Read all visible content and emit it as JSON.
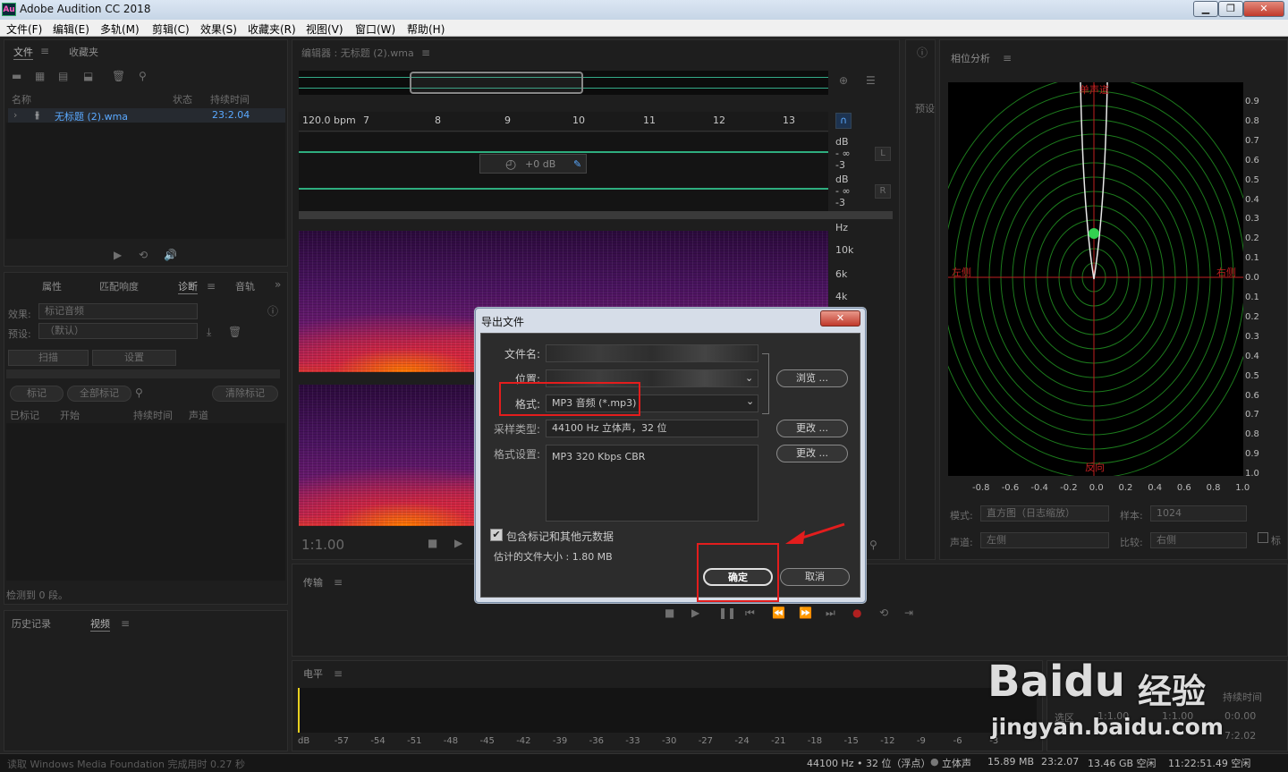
{
  "window": {
    "app_icon": "Au",
    "title": "Adobe Audition CC 2018",
    "min": "▁",
    "max": "❐",
    "close": "✕"
  },
  "menu": [
    "文件(F)",
    "编辑(E)",
    "多轨(M)",
    "剪辑(C)",
    "效果(S)",
    "收藏夹(R)",
    "视图(V)",
    "窗口(W)",
    "帮助(H)"
  ],
  "files_panel": {
    "tab_files": "文件",
    "tab_favorites": "收藏夹",
    "col_name": "名称",
    "col_status": "状态",
    "col_duration": "持续时间",
    "file_name": "无标题 (2).wma",
    "file_duration": "23:2.04"
  },
  "props_panel": {
    "tab_properties": "属性",
    "tab_match": "匹配响度",
    "tab_diagnostics": "诊断",
    "tab_audio": "音轨",
    "effect_label": "效果:",
    "effect_value": "标记音频",
    "preset_label": "预设:",
    "preset_value": "（默认）",
    "scan_button": "扫描",
    "settings_button": "设置",
    "mark_button": "标记",
    "mark_all_button": "全部标记",
    "clear_button": "清除标记",
    "col_marked": "已标记",
    "col_start": "开始",
    "col_duration": "持续时间",
    "col_channel": "声道",
    "detected": "检测到 0 段。"
  },
  "history_panel": {
    "tab_history": "历史记录",
    "tab_video": "视频"
  },
  "editor": {
    "title": "编辑器 : 无标题 (2).wma",
    "bpm": "120.0 bpm",
    "ruler": [
      "7",
      "8",
      "9",
      "10",
      "11",
      "12",
      "13"
    ],
    "db_labels": [
      "dB",
      "- ∞",
      "-3",
      "dB",
      "- ∞",
      "-3"
    ],
    "ch_left": "L",
    "ch_right": "R",
    "gain": "+0 dB",
    "hz_labels": [
      "Hz",
      "10k",
      "6k",
      "4k"
    ],
    "time": "1:1.00"
  },
  "transport_panel": {
    "title": "传输"
  },
  "levels_panel": {
    "title": "电平",
    "scale": [
      "dB",
      "-57",
      "-54",
      "-51",
      "-48",
      "-45",
      "-42",
      "-39",
      "-36",
      "-33",
      "-30",
      "-27",
      "-24",
      "-21",
      "-18",
      "-15",
      "-12",
      "-9",
      "-6",
      "-3"
    ]
  },
  "presets_tab": "预设",
  "phase_panel": {
    "title": "相位分析",
    "top_label": "单声道",
    "left_label": "左侧",
    "right_label": "右侧",
    "bottom_label": "反向",
    "y_ticks": [
      "0.9",
      "0.8",
      "0.7",
      "0.6",
      "0.5",
      "0.4",
      "0.3",
      "0.2",
      "0.1",
      "0.0",
      "0.1",
      "0.2",
      "0.3",
      "0.4",
      "0.5",
      "0.6",
      "0.7",
      "0.8",
      "0.9",
      "1.0"
    ],
    "x_ticks": [
      "-0.8",
      "-0.6",
      "-0.4",
      "-0.2",
      "0.0",
      "0.2",
      "0.4",
      "0.6",
      "0.8",
      "1.0"
    ],
    "mode_label": "模式:",
    "mode_value": "直方图（日志缩放）",
    "sample_label": "样本:",
    "sample_value": "1024",
    "channel_label": "声道:",
    "channel_value": "左侧",
    "compare_label": "比较:",
    "compare_value": "右侧",
    "mark_label": "标"
  },
  "selection_panel": {
    "duration_label": "持续时间",
    "selection_label": "选区",
    "sel_start": "1:1.00",
    "sel_end": "1:1.00",
    "duration_value": "0:0.00",
    "view_end": "7:2.02"
  },
  "dialog": {
    "title": "导出文件",
    "close": "✕",
    "filename_label": "文件名:",
    "location_label": "位置:",
    "browse_button": "浏览 ...",
    "format_label": "格式:",
    "format_value": "MP3 音频 (*.mp3)",
    "sample_type_label": "采样类型:",
    "sample_type_value": "44100 Hz 立体声，32 位",
    "change_button": "更改 ...",
    "format_settings_label": "格式设置:",
    "format_settings_value": "MP3 320 Kbps CBR",
    "change_button2": "更改 ...",
    "include_markers": "包含标记和其他元数据",
    "est_size": "估计的文件大小 : 1.80 MB",
    "ok_button": "确定",
    "cancel_button": "取消"
  },
  "status": {
    "left": "读取 Windows Media Foundation 完成用时 0.27 秒",
    "format": "44100 Hz • 32 位（浮点）",
    "stereo": "立体声",
    "size": "15.89 MB",
    "duration": "23:2.07",
    "free": "13.46 GB 空闲",
    "free_time": "11:22:51.49 空闲"
  },
  "watermark": {
    "logo": "Baidu",
    "brand": "经验",
    "url": "jingyan.baidu.com"
  },
  "colors": {
    "accent_red": "#e31d1d",
    "wave_green": "#35d49a",
    "phase_grid": "#1c7a1c"
  }
}
